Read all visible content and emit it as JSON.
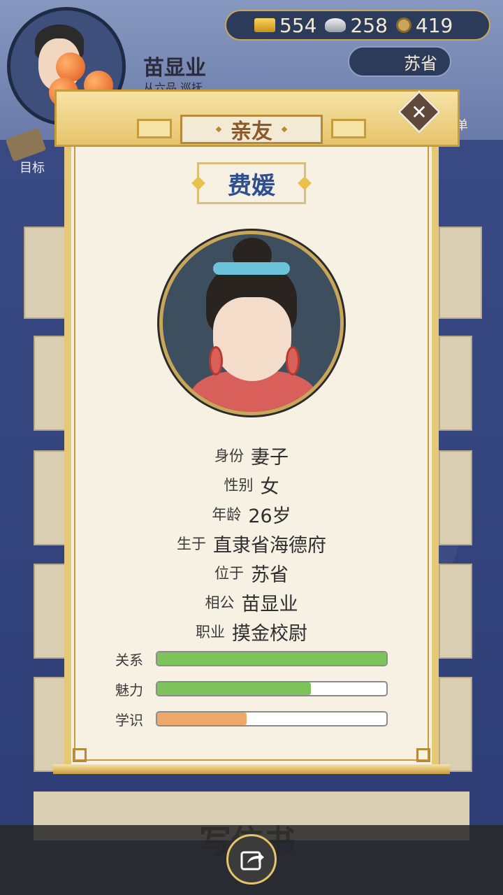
{
  "header": {
    "player_name": "苗显业",
    "player_title": "从六品 巡抚",
    "currency": {
      "gold": "554",
      "silver": "258",
      "coin": "419"
    },
    "location": "苏省",
    "menu_label": "菜单",
    "goal_label": "目标"
  },
  "dialog": {
    "title": "亲友",
    "person": {
      "name": "费媛",
      "fields": [
        {
          "label": "身份",
          "value": "妻子"
        },
        {
          "label": "性别",
          "value": "女"
        },
        {
          "label": "年龄",
          "value": "26岁"
        },
        {
          "label": "生于",
          "value": "直隶省海德府"
        },
        {
          "label": "位于",
          "value": "苏省"
        },
        {
          "label": "相公",
          "value": "苗显业"
        },
        {
          "label": "职业",
          "value": "摸金校尉"
        }
      ],
      "stats": [
        {
          "label": "关系",
          "fraction": 1.0,
          "color": "#7cc35a"
        },
        {
          "label": "魅力",
          "fraction": 0.67,
          "color": "#7cc35a"
        },
        {
          "label": "学识",
          "fraction": 0.39,
          "color": "#eda86a"
        }
      ]
    }
  },
  "bottom": {
    "write_label": "写信书"
  }
}
